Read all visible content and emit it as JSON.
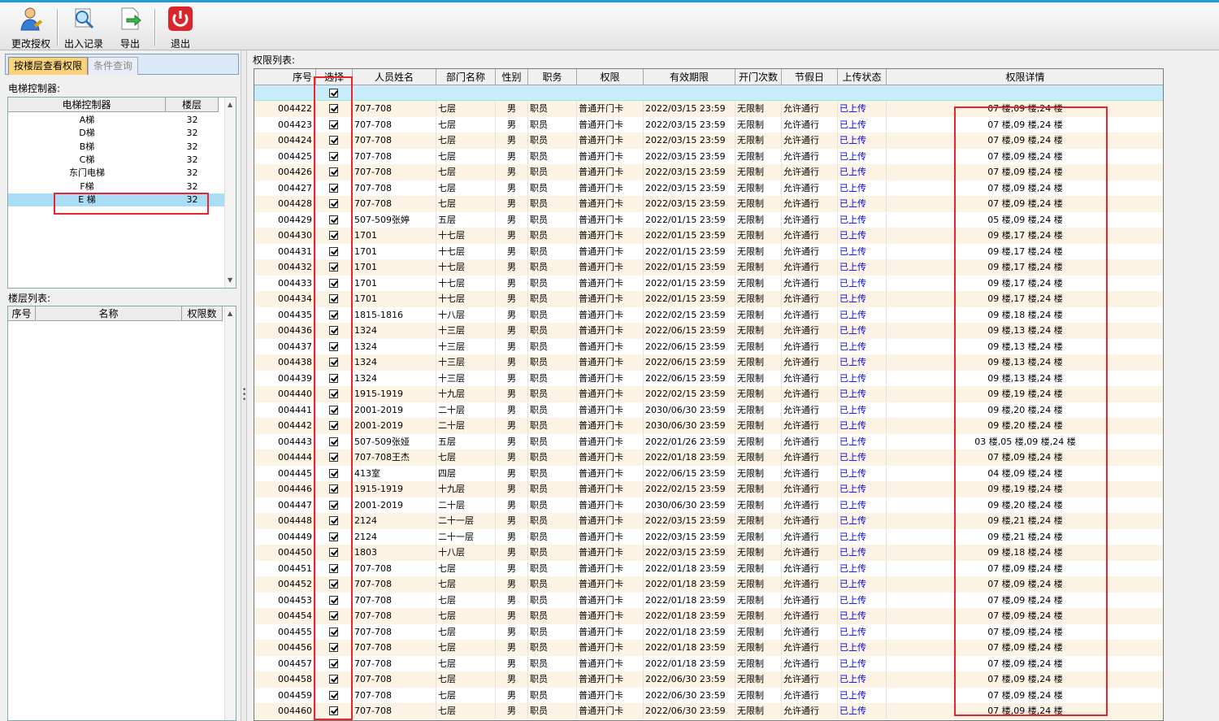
{
  "toolbar": {
    "buttons": [
      {
        "label": "更改授权",
        "icon": "user-edit-icon"
      },
      {
        "label": "出入记录",
        "icon": "search-log-icon"
      },
      {
        "label": "导出",
        "icon": "export-icon"
      },
      {
        "label": "退出",
        "icon": "power-icon"
      }
    ]
  },
  "left": {
    "tabs": [
      "按楼层查看权限",
      "条件查询"
    ],
    "controller_label": "电梯控制器:",
    "controller_headers": [
      "电梯控制器",
      "楼层"
    ],
    "controllers": [
      {
        "name": "A梯",
        "floors": "32"
      },
      {
        "name": "D梯",
        "floors": "32"
      },
      {
        "name": "B梯",
        "floors": "32"
      },
      {
        "name": "C梯",
        "floors": "32"
      },
      {
        "name": "东门电梯",
        "floors": "32"
      },
      {
        "name": "F梯",
        "floors": "32"
      },
      {
        "name": "E 梯",
        "floors": "32"
      }
    ],
    "floor_label": "楼层列表:",
    "floor_headers": [
      "序号",
      "名称",
      "权限数"
    ]
  },
  "right": {
    "label": "权限列表:",
    "headers": [
      "序号",
      "选择",
      "人员姓名",
      "部门名称",
      "性别",
      "职务",
      "权限",
      "有效期限",
      "开门次数",
      "节假日",
      "上传状态",
      "权限详情"
    ],
    "rows": [
      [
        "004422",
        "707-708",
        "七层",
        "男",
        "职员",
        "普通开门卡",
        "2022/03/15 23:59",
        "无限制",
        "允许通行",
        "已上传",
        "07 楼,09 楼,24 楼"
      ],
      [
        "004423",
        "707-708",
        "七层",
        "男",
        "职员",
        "普通开门卡",
        "2022/03/15 23:59",
        "无限制",
        "允许通行",
        "已上传",
        "07 楼,09 楼,24 楼"
      ],
      [
        "004424",
        "707-708",
        "七层",
        "男",
        "职员",
        "普通开门卡",
        "2022/03/15 23:59",
        "无限制",
        "允许通行",
        "已上传",
        "07 楼,09 楼,24 楼"
      ],
      [
        "004425",
        "707-708",
        "七层",
        "男",
        "职员",
        "普通开门卡",
        "2022/03/15 23:59",
        "无限制",
        "允许通行",
        "已上传",
        "07 楼,09 楼,24 楼"
      ],
      [
        "004426",
        "707-708",
        "七层",
        "男",
        "职员",
        "普通开门卡",
        "2022/03/15 23:59",
        "无限制",
        "允许通行",
        "已上传",
        "07 楼,09 楼,24 楼"
      ],
      [
        "004427",
        "707-708",
        "七层",
        "男",
        "职员",
        "普通开门卡",
        "2022/03/15 23:59",
        "无限制",
        "允许通行",
        "已上传",
        "07 楼,09 楼,24 楼"
      ],
      [
        "004428",
        "707-708",
        "七层",
        "男",
        "职员",
        "普通开门卡",
        "2022/03/15 23:59",
        "无限制",
        "允许通行",
        "已上传",
        "07 楼,09 楼,24 楼"
      ],
      [
        "004429",
        "507-509张婷",
        "五层",
        "男",
        "职员",
        "普通开门卡",
        "2022/01/15 23:59",
        "无限制",
        "允许通行",
        "已上传",
        "05 楼,09 楼,24 楼"
      ],
      [
        "004430",
        "1701",
        "十七层",
        "男",
        "职员",
        "普通开门卡",
        "2022/01/15 23:59",
        "无限制",
        "允许通行",
        "已上传",
        "09 楼,17 楼,24 楼"
      ],
      [
        "004431",
        "1701",
        "十七层",
        "男",
        "职员",
        "普通开门卡",
        "2022/01/15 23:59",
        "无限制",
        "允许通行",
        "已上传",
        "09 楼,17 楼,24 楼"
      ],
      [
        "004432",
        "1701",
        "十七层",
        "男",
        "职员",
        "普通开门卡",
        "2022/01/15 23:59",
        "无限制",
        "允许通行",
        "已上传",
        "09 楼,17 楼,24 楼"
      ],
      [
        "004433",
        "1701",
        "十七层",
        "男",
        "职员",
        "普通开门卡",
        "2022/01/15 23:59",
        "无限制",
        "允许通行",
        "已上传",
        "09 楼,17 楼,24 楼"
      ],
      [
        "004434",
        "1701",
        "十七层",
        "男",
        "职员",
        "普通开门卡",
        "2022/01/15 23:59",
        "无限制",
        "允许通行",
        "已上传",
        "09 楼,17 楼,24 楼"
      ],
      [
        "004435",
        "1815-1816",
        "十八层",
        "男",
        "职员",
        "普通开门卡",
        "2022/02/15 23:59",
        "无限制",
        "允许通行",
        "已上传",
        "09 楼,18 楼,24 楼"
      ],
      [
        "004436",
        "1324",
        "十三层",
        "男",
        "职员",
        "普通开门卡",
        "2022/06/15 23:59",
        "无限制",
        "允许通行",
        "已上传",
        "09 楼,13 楼,24 楼"
      ],
      [
        "004437",
        "1324",
        "十三层",
        "男",
        "职员",
        "普通开门卡",
        "2022/06/15 23:59",
        "无限制",
        "允许通行",
        "已上传",
        "09 楼,13 楼,24 楼"
      ],
      [
        "004438",
        "1324",
        "十三层",
        "男",
        "职员",
        "普通开门卡",
        "2022/06/15 23:59",
        "无限制",
        "允许通行",
        "已上传",
        "09 楼,13 楼,24 楼"
      ],
      [
        "004439",
        "1324",
        "十三层",
        "男",
        "职员",
        "普通开门卡",
        "2022/06/15 23:59",
        "无限制",
        "允许通行",
        "已上传",
        "09 楼,13 楼,24 楼"
      ],
      [
        "004440",
        "1915-1919",
        "十九层",
        "男",
        "职员",
        "普通开门卡",
        "2022/02/15 23:59",
        "无限制",
        "允许通行",
        "已上传",
        "09 楼,19 楼,24 楼"
      ],
      [
        "004441",
        "2001-2019",
        "二十层",
        "男",
        "职员",
        "普通开门卡",
        "2030/06/30 23:59",
        "无限制",
        "允许通行",
        "已上传",
        "09 楼,20 楼,24 楼"
      ],
      [
        "004442",
        "2001-2019",
        "二十层",
        "男",
        "职员",
        "普通开门卡",
        "2030/06/30 23:59",
        "无限制",
        "允许通行",
        "已上传",
        "09 楼,20 楼,24 楼"
      ],
      [
        "004443",
        "507-509张娅",
        "五层",
        "男",
        "职员",
        "普通开门卡",
        "2022/01/26 23:59",
        "无限制",
        "允许通行",
        "已上传",
        "03 楼,05 楼,09 楼,24 楼"
      ],
      [
        "004444",
        "707-708王杰",
        "七层",
        "男",
        "职员",
        "普通开门卡",
        "2022/01/18 23:59",
        "无限制",
        "允许通行",
        "已上传",
        "07 楼,09 楼,24 楼"
      ],
      [
        "004445",
        "413室",
        "四层",
        "男",
        "职员",
        "普通开门卡",
        "2022/06/15 23:59",
        "无限制",
        "允许通行",
        "已上传",
        "04 楼,09 楼,24 楼"
      ],
      [
        "004446",
        "1915-1919",
        "十九层",
        "男",
        "职员",
        "普通开门卡",
        "2022/02/15 23:59",
        "无限制",
        "允许通行",
        "已上传",
        "09 楼,19 楼,24 楼"
      ],
      [
        "004447",
        "2001-2019",
        "二十层",
        "男",
        "职员",
        "普通开门卡",
        "2030/06/30 23:59",
        "无限制",
        "允许通行",
        "已上传",
        "09 楼,20 楼,24 楼"
      ],
      [
        "004448",
        "2124",
        "二十一层",
        "男",
        "职员",
        "普通开门卡",
        "2022/03/15 23:59",
        "无限制",
        "允许通行",
        "已上传",
        "09 楼,21 楼,24 楼"
      ],
      [
        "004449",
        "2124",
        "二十一层",
        "男",
        "职员",
        "普通开门卡",
        "2022/03/15 23:59",
        "无限制",
        "允许通行",
        "已上传",
        "09 楼,21 楼,24 楼"
      ],
      [
        "004450",
        "1803",
        "十八层",
        "男",
        "职员",
        "普通开门卡",
        "2022/03/15 23:59",
        "无限制",
        "允许通行",
        "已上传",
        "09 楼,18 楼,24 楼"
      ],
      [
        "004451",
        "707-708",
        "七层",
        "男",
        "职员",
        "普通开门卡",
        "2022/01/18 23:59",
        "无限制",
        "允许通行",
        "已上传",
        "07 楼,09 楼,24 楼"
      ],
      [
        "004452",
        "707-708",
        "七层",
        "男",
        "职员",
        "普通开门卡",
        "2022/01/18 23:59",
        "无限制",
        "允许通行",
        "已上传",
        "07 楼,09 楼,24 楼"
      ],
      [
        "004453",
        "707-708",
        "七层",
        "男",
        "职员",
        "普通开门卡",
        "2022/01/18 23:59",
        "无限制",
        "允许通行",
        "已上传",
        "07 楼,09 楼,24 楼"
      ],
      [
        "004454",
        "707-708",
        "七层",
        "男",
        "职员",
        "普通开门卡",
        "2022/01/18 23:59",
        "无限制",
        "允许通行",
        "已上传",
        "07 楼,09 楼,24 楼"
      ],
      [
        "004455",
        "707-708",
        "七层",
        "男",
        "职员",
        "普通开门卡",
        "2022/01/18 23:59",
        "无限制",
        "允许通行",
        "已上传",
        "07 楼,09 楼,24 楼"
      ],
      [
        "004456",
        "707-708",
        "七层",
        "男",
        "职员",
        "普通开门卡",
        "2022/01/18 23:59",
        "无限制",
        "允许通行",
        "已上传",
        "07 楼,09 楼,24 楼"
      ],
      [
        "004457",
        "707-708",
        "七层",
        "男",
        "职员",
        "普通开门卡",
        "2022/01/18 23:59",
        "无限制",
        "允许通行",
        "已上传",
        "07 楼,09 楼,24 楼"
      ],
      [
        "004458",
        "707-708",
        "七层",
        "男",
        "职员",
        "普通开门卡",
        "2022/06/30 23:59",
        "无限制",
        "允许通行",
        "已上传",
        "07 楼,09 楼,24 楼"
      ],
      [
        "004459",
        "707-708",
        "七层",
        "男",
        "职员",
        "普通开门卡",
        "2022/06/30 23:59",
        "无限制",
        "允许通行",
        "已上传",
        "07 楼,09 楼,24 楼"
      ],
      [
        "004460",
        "707-708",
        "七层",
        "男",
        "职员",
        "普通开门卡",
        "2022/06/30 23:59",
        "无限制",
        "允许通行",
        "已上传",
        "07 楼,09 楼,24 楼"
      ]
    ]
  },
  "colors": {
    "highlight": "#e8242c",
    "link": "#0000ee",
    "selected_row": "#a9dcf5",
    "active_tab": "#fbd37a"
  }
}
